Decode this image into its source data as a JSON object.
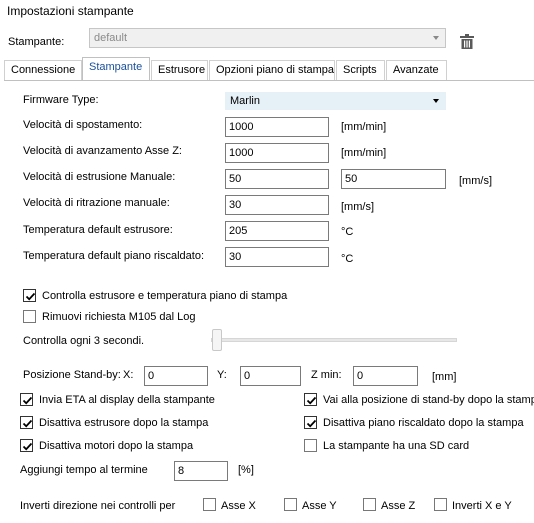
{
  "window": {
    "title": "Impostazioni stampante"
  },
  "printer": {
    "label": "Stampante:",
    "value": "default"
  },
  "tabs": [
    {
      "label": "Connessione"
    },
    {
      "label": "Stampante"
    },
    {
      "label": "Estrusore"
    },
    {
      "label": "Opzioni piano di stampa"
    },
    {
      "label": "Scripts"
    },
    {
      "label": "Avanzate"
    }
  ],
  "firmware": {
    "label": "Firmware Type:",
    "value": "Marlin"
  },
  "move_speed": {
    "label": "Velocità di spostamento:",
    "value": "1000",
    "unit": "[mm/min]"
  },
  "z_speed": {
    "label": "Velocità di avanzamento Asse Z:",
    "value": "1000",
    "unit": "[mm/min]"
  },
  "manual_extrusion": {
    "label": "Velocità di estrusione Manuale:",
    "value1": "50",
    "value2": "50",
    "unit": "[mm/s]"
  },
  "manual_retraction": {
    "label": "Velocità di ritrazione manuale:",
    "value": "30",
    "unit": "[mm/s]"
  },
  "extruder_temp": {
    "label": "Temperatura default estrusore:",
    "value": "205",
    "unit": "°C"
  },
  "bed_temp": {
    "label": "Temperatura default piano riscaldato:",
    "value": "30",
    "unit": "°C"
  },
  "check_temp": {
    "label": "Controlla estrusore e temperatura piano di stampa",
    "checked": true
  },
  "remove_m105": {
    "label": "Rimuovi richiesta M105 dal Log",
    "checked": false
  },
  "check_interval": {
    "label": "Controlla ogni 3 secondi.",
    "slider_value": 3
  },
  "standby": {
    "label": "Posizione Stand-by:",
    "x_label": "X:",
    "x_value": "0",
    "y_label": "Y:",
    "y_value": "0",
    "z_label": "Z min:",
    "z_value": "0",
    "unit": "[mm]"
  },
  "options": {
    "send_eta": {
      "label": "Invia ETA al display della stampante",
      "checked": true
    },
    "goto_standby": {
      "label": "Vai alla posizione di stand-by dopo la stampa",
      "checked": true
    },
    "disable_extruder": {
      "label": "Disattiva estrusore dopo la stampa",
      "checked": true
    },
    "disable_bed": {
      "label": "Disattiva piano riscaldato dopo la stampa",
      "checked": true
    },
    "disable_motors": {
      "label": "Disattiva motori dopo la stampa",
      "checked": true
    },
    "sd_card": {
      "label": "La stampante ha una SD card",
      "checked": false
    }
  },
  "add_time": {
    "label": "Aggiungi tempo al termine",
    "value": "8",
    "unit": "[%]"
  },
  "invert": {
    "label": "Inverti direzione nei controlli per",
    "x": {
      "label": "Asse X",
      "checked": false
    },
    "y": {
      "label": "Asse Y",
      "checked": false
    },
    "z": {
      "label": "Asse Z",
      "checked": false
    },
    "xy": {
      "label": "Inverti X e Y",
      "checked": false
    }
  },
  "icons": {
    "delete": "trash-icon",
    "dropdown": "chevron-down-icon",
    "check": "checkmark-icon"
  }
}
